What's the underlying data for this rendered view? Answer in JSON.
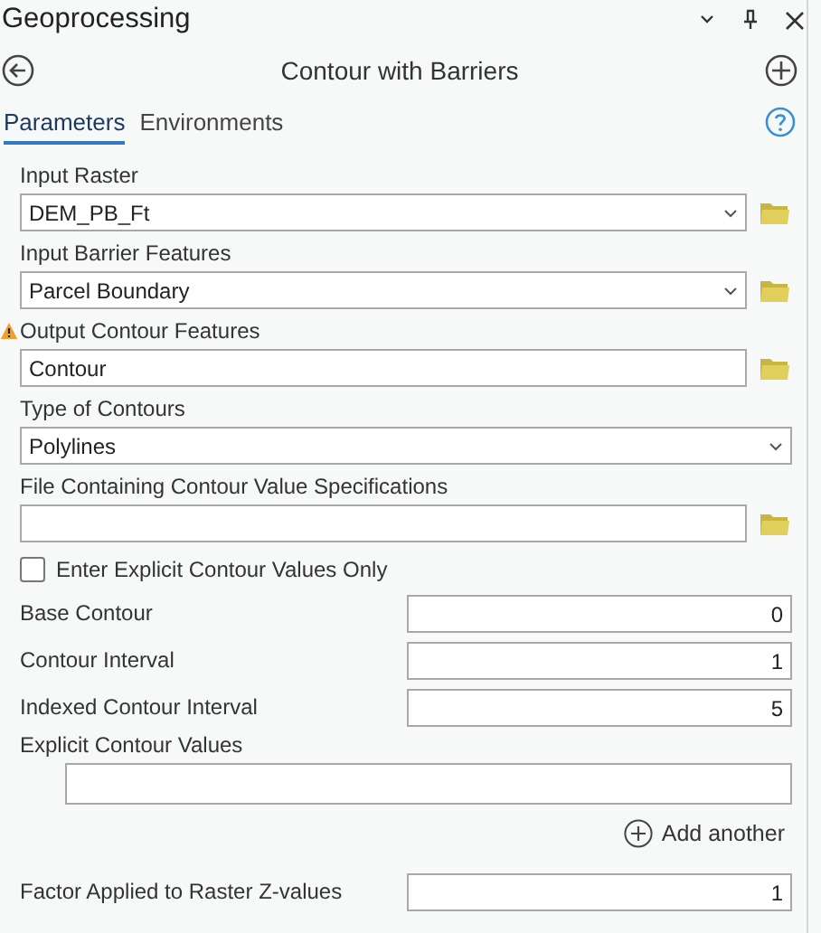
{
  "pane": {
    "title": "Geoprocessing"
  },
  "tool": {
    "title": "Contour with Barriers"
  },
  "tabs": [
    {
      "label": "Parameters",
      "selected": true
    },
    {
      "label": "Environments",
      "selected": false
    }
  ],
  "parameters": [
    {
      "kind": "dropdown",
      "label": "Input Raster",
      "value": "DEM_PB_Ft",
      "browse": true,
      "warning": false
    },
    {
      "kind": "dropdown",
      "label": "Input Barrier Features",
      "value": "Parcel Boundary",
      "browse": true,
      "warning": false
    },
    {
      "kind": "text",
      "label": "Output Contour Features",
      "value": "Contour",
      "browse": true,
      "warning": true
    },
    {
      "kind": "dropdown",
      "label": "Type of Contours",
      "value": "Polylines",
      "browse": false,
      "warning": false
    },
    {
      "kind": "text",
      "label": "File Containing Contour Value Specifications",
      "browse": true,
      "warning": false
    },
    {
      "kind": "checkbox",
      "label": "Enter Explicit Contour Values Only",
      "checked": false
    },
    {
      "kind": "number",
      "label": "Base Contour",
      "value": "0"
    },
    {
      "kind": "number",
      "label": "Contour Interval",
      "value": "1"
    },
    {
      "kind": "number",
      "label": "Indexed Contour Interval",
      "value": "5"
    },
    {
      "kind": "multi",
      "label": "Explicit Contour Values"
    },
    {
      "kind": "add",
      "label": "Add another"
    },
    {
      "kind": "number",
      "label": "Factor Applied to Raster Z-values",
      "value": "1"
    }
  ]
}
